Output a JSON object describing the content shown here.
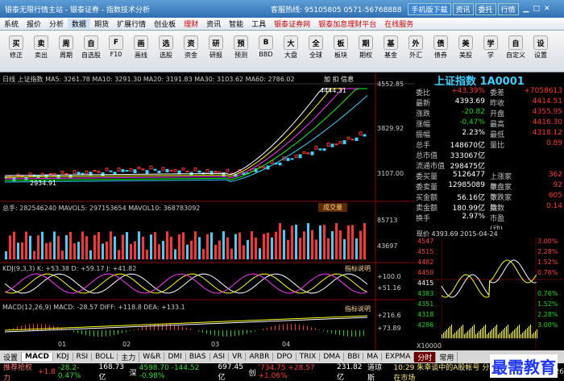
{
  "title_bar": {
    "text": "银泰无限行情主站 - 银泰证券 - 指数技术分析",
    "hotline": "客服热线: 95105805 0571-56768888",
    "buttons": [
      "手机版下载",
      "资讯",
      "委托",
      "行情"
    ]
  },
  "menu": [
    "系统",
    "报价",
    "分析",
    "数据",
    "期货",
    "扩展行情",
    "创业板",
    "理财",
    "资讯",
    "智能",
    "工具",
    "银泰证券网",
    "银泰加息理财平台",
    "在线服务"
  ],
  "toolbar": [
    [
      "修正",
      "买"
    ],
    [
      "卖出",
      "卖"
    ],
    [
      "周期",
      "周"
    ],
    [
      "自选股",
      "自"
    ],
    [
      "F10",
      "F"
    ],
    [
      "画线",
      "画"
    ],
    [
      "选股",
      "选"
    ],
    [
      "资金",
      "资"
    ],
    [
      "研报",
      "研"
    ],
    [
      "预测",
      "预"
    ],
    [
      "BBD",
      "B"
    ],
    [
      "大盘",
      "大"
    ],
    [
      "全球",
      "全"
    ],
    [
      "板块",
      "板"
    ],
    [
      "期权",
      "期"
    ],
    [
      "基金",
      "基"
    ],
    [
      "外汇",
      "外"
    ],
    [
      "债券",
      "债"
    ],
    [
      "美股",
      "美"
    ],
    [
      "学",
      "学"
    ],
    [
      "自定义",
      "自"
    ],
    [
      "设置",
      "设"
    ]
  ],
  "chart_header": "日线   上证指数  MA5: 3261.78  MA10: 3291.30  MA20: 3191.83  MA30: 3103.62  MA60: 2786.02",
  "chart_header_right": "加  扣  信息",
  "price_labels": {
    "high": "4552.85",
    "mid": "3829.92",
    "low": "3107.00",
    "peak": "4444.31",
    "trough": "2934.91"
  },
  "volume_header": "总手: 282546240  MAVOL5: 297153654  MAVOL10: 368783092",
  "volume_labels": [
    "85713",
    "43697"
  ],
  "volume_btn": "成交量",
  "kdj_header": "KDJ(9,3,3)  K: +53.38  D: +59.17  J: +41.82",
  "kdj_labels": [
    "+100.0",
    "+51.16"
  ],
  "kdj_btn": "指标说明",
  "macd_header": "MACD(12,26,9)  MACD: -28.57  DIFF: +118.8  DEA: +133.1",
  "macd_labels": [
    "+216.6",
    "+73.89"
  ],
  "macd_btn": "指标说明",
  "months": [
    "01",
    "02",
    "03",
    "04"
  ],
  "quote": {
    "name": "上证指数 1A0001",
    "rows": [
      [
        "委比",
        "+43.39%",
        "委差",
        "+7058613"
      ],
      [
        "最新",
        "4393.69",
        "昨收",
        "4414.51"
      ],
      [
        "涨跌",
        "-20.82",
        "开盘",
        "4355.95"
      ],
      [
        "涨幅",
        "-0.47%",
        "最高",
        "4416.30"
      ],
      [
        "振幅",
        "2.23%",
        "最低",
        "4318.12"
      ],
      [
        "总手",
        "148670亿",
        "量比",
        "0.89"
      ],
      [
        "总市值",
        "333067亿",
        "",
        ""
      ],
      [
        "流通市值",
        "298475亿",
        "",
        ""
      ],
      [
        "委买量",
        "5126477",
        "上涨家数",
        "362"
      ],
      [
        "委卖量",
        "12985089",
        "平盘家数",
        "92"
      ],
      [
        "买金额",
        "56.16亿",
        "下跌家数",
        "605"
      ],
      [
        "卖金额",
        "180.99亿",
        "指数",
        "0.14"
      ],
      [
        "换手",
        "2.97%",
        "市盈(动)",
        ""
      ]
    ]
  },
  "intraday": {
    "header": "现价 4393.69     2015-04-24",
    "price_labels": [
      "4547",
      "4515",
      "4482",
      "4450",
      "4415",
      "4383",
      "4351",
      "4318",
      "4286"
    ],
    "pct_labels": [
      "3.00%",
      "2.28%",
      "1.52%",
      "0.76%",
      "0.76%",
      "1.52%",
      "2.28%",
      "3.00%"
    ],
    "vol_label": "X10000"
  },
  "bottom_tabs": [
    "设置",
    "MACD",
    "KDJ",
    "RSI",
    "BOLL",
    "主力",
    "W&R",
    "DMI",
    "BIAS",
    "ASI",
    "VR",
    "ARBR",
    "DPO",
    "TRIX",
    "DMA",
    "BBI",
    "MA",
    "EXPMA",
    "分时",
    "常用"
  ],
  "ticker": {
    "left": "推荐抢权力",
    "segments": [
      {
        "text": "+1.8",
        "cls": "r"
      },
      {
        "text": "-28.2-0.47%",
        "cls": "g"
      },
      {
        "text": "168.73亿",
        "cls": "white"
      },
      {
        "text": "深",
        "cls": "white"
      },
      {
        "text": "4598.70 -144.52 -0.98%",
        "cls": "g"
      },
      {
        "text": "697.45亿",
        "cls": "white"
      },
      {
        "text": "创",
        "cls": "white"
      },
      {
        "text": "'734.75 +28.57 +1.06%",
        "cls": "r"
      },
      {
        "text": "231.82亿",
        "cls": "white"
      },
      {
        "text": "道琼斯",
        "cls": "white"
      }
    ],
    "news": "10:29 朱幸谈中的A股帐号 分析发具知道在市场",
    "time": "11:53:26"
  },
  "watermark": "最需教育"
}
